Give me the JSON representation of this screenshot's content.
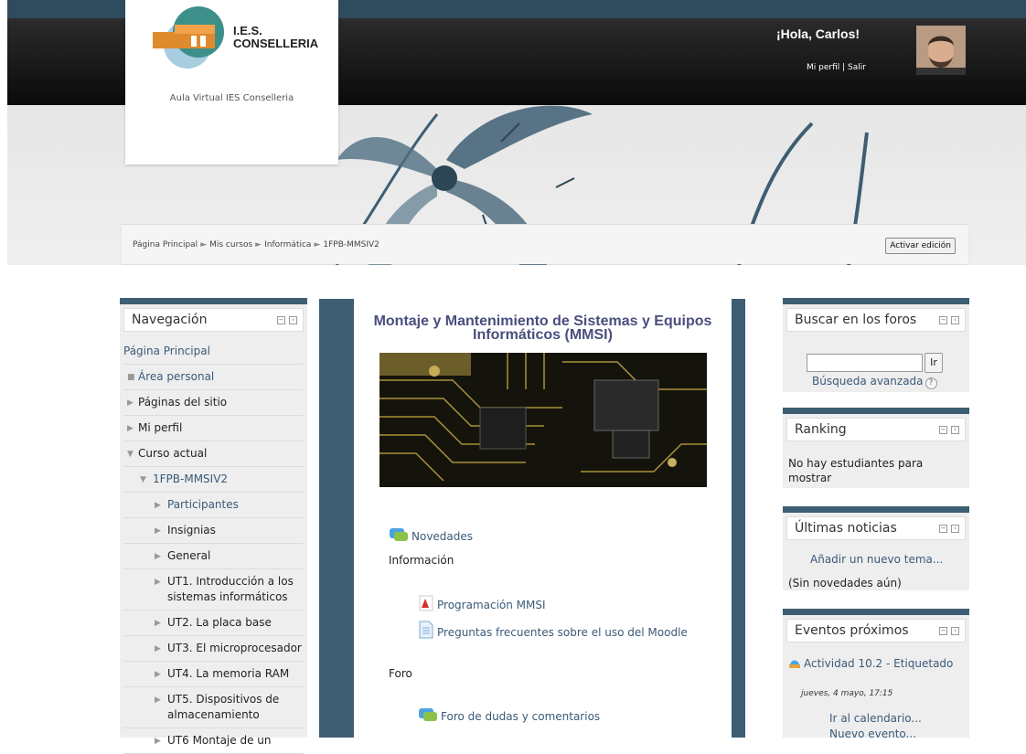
{
  "header": {
    "logo_line1": "I.E.S.",
    "logo_line2": "CONSELLERIA",
    "tagline": "Aula Virtual IES Conselleria",
    "greeting": "¡Hola, Carlos!",
    "profile_link": "Mi perfil",
    "separator": " | ",
    "logout_link": "Salir"
  },
  "breadcrumb": {
    "items": [
      "Página Principal",
      "Mis cursos",
      "Informática",
      "1FPB-MMSIV2"
    ],
    "separator": "►"
  },
  "edit_button": "Activar edición",
  "navigation": {
    "title": "Navegación",
    "items": [
      {
        "label": "Página Principal"
      },
      {
        "label": "Área personal"
      },
      {
        "label": "Páginas del sitio"
      },
      {
        "label": "Mi perfil"
      },
      {
        "label": "Curso actual"
      },
      {
        "label": "1FPB-MMSIV2"
      },
      {
        "label": "Participantes"
      },
      {
        "label": "Insignias"
      },
      {
        "label": "General"
      },
      {
        "label": "UT1. Introducción a los sistemas informáticos"
      },
      {
        "label": "UT2. La placa base"
      },
      {
        "label": "UT3. El microprocesador"
      },
      {
        "label": "UT4. La memoria RAM"
      },
      {
        "label": "UT5. Dispositivos de almacenamiento"
      },
      {
        "label": "UT6 Montaje de un"
      }
    ]
  },
  "course": {
    "title": "Montaje y Mantenimiento de Sistemas y Equipos Informáticos (MMSI)",
    "news_forum": "Novedades",
    "section_info": "Información",
    "program_link": "Programación MMSI",
    "faq_link": "Preguntas frecuentes sobre el uso del Moodle",
    "section_forum": "Foro",
    "forum_link": "Foro de dudas y comentarios"
  },
  "search_block": {
    "title": "Buscar en los foros",
    "go_button": "Ir",
    "advanced": "Búsqueda avanzada",
    "help": "?"
  },
  "ranking_block": {
    "title": "Ranking",
    "text": "No hay estudiantes para mostrar"
  },
  "news_block": {
    "title": "Últimas noticias",
    "add": "Añadir un nuevo tema...",
    "empty": "(Sin novedades aún)"
  },
  "events_block": {
    "title": "Eventos próximos",
    "event": "Actividad 10.2 - Etiquetado",
    "date": "jueves, 4 mayo, 17:15",
    "calendar": "Ir al calendario...",
    "new_event": "Nuevo evento..."
  },
  "colors": {
    "accent": "#3d5e73",
    "title": "#4a4e7d",
    "link": "#3a5a78"
  }
}
